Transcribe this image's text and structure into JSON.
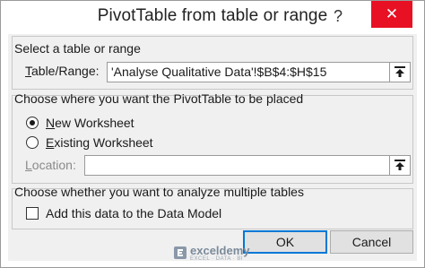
{
  "window": {
    "title": "PivotTable from table or range",
    "help_label": "?",
    "close_label": "✕"
  },
  "source": {
    "heading": "Select a table or range",
    "table_range_label_key": "T",
    "table_range_label_rest": "able/Range:",
    "table_range_value": "'Analyse Qualitative Data'!$B$4:$H$15"
  },
  "placement": {
    "heading": "Choose where you want the PivotTable to be placed",
    "new_worksheet_key": "N",
    "new_worksheet_rest": "ew Worksheet",
    "new_worksheet_checked": true,
    "existing_worksheet_key": "E",
    "existing_worksheet_rest": "xisting Worksheet",
    "existing_worksheet_checked": false,
    "location_label_key": "L",
    "location_label_rest": "ocation:",
    "location_value": ""
  },
  "multiple_tables": {
    "heading": "Choose whether you want to analyze multiple tables",
    "data_model_label": "Add this data to the Data Model",
    "data_model_checked": false
  },
  "buttons": {
    "ok_label": "OK",
    "cancel_label": "Cancel"
  },
  "watermark": {
    "brand": "exceldemy",
    "tagline": "EXCEL · DATA · BI"
  },
  "colors": {
    "close_button": "#e81123",
    "dialog_background": "#f0f0f0",
    "default_button_border": "#0078d7"
  }
}
